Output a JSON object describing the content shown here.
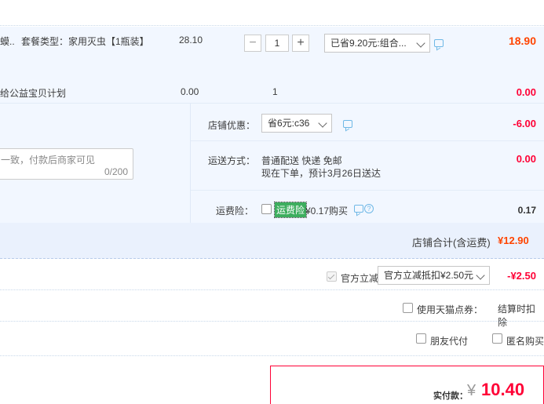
{
  "product": {
    "name_frag": "蟆..",
    "package": "套餐类型：家用灭虫【1瓶装】",
    "unit_price": "28.10",
    "quantity": "1",
    "minus": "−",
    "plus": "+",
    "discount_select": "已省9.20元:组合...",
    "subtotal": "18.90"
  },
  "charity": {
    "label": "给公益宝贝计划",
    "price": "0.00",
    "qty": "1",
    "subtotal": "0.00"
  },
  "message": {
    "placeholder": "一致，付款后商家可见",
    "count": "0/200"
  },
  "shop_discount": {
    "label": "店铺优惠：",
    "select": "省6元:c36",
    "amount": "-6.00"
  },
  "shipping": {
    "label": "运送方式：",
    "method": "普通配送 快递 免邮",
    "eta": "现在下单，预计3月26日送达",
    "amount": "0.00"
  },
  "insurance": {
    "label": "运费险：",
    "tag": "运费险",
    "price": "¥0.17购买",
    "amount": "0.17"
  },
  "shop_total": {
    "label": "店铺合计(含运费)",
    "amount": "¥12.90"
  },
  "official_discount": {
    "label": "官方立减",
    "select": "官方立减抵扣¥2.50元",
    "amount": "-¥2.50"
  },
  "points": {
    "label": "使用天猫点券：",
    "note": "结算时扣除"
  },
  "options": {
    "friend_pay": "朋友代付",
    "anonymous": "匿名购买"
  },
  "payment": {
    "label": "实付款：",
    "currency": "¥",
    "amount": "10.40"
  },
  "colors": {
    "accent_red": "#ff0036",
    "price_orange": "#ff4400",
    "panel_blue": "#f2f7ff",
    "insurance_green": "#3dae5e"
  },
  "icons": [
    "minus-icon",
    "plus-icon",
    "chevron-down-icon",
    "chat-icon",
    "help-icon",
    "checkbox"
  ]
}
